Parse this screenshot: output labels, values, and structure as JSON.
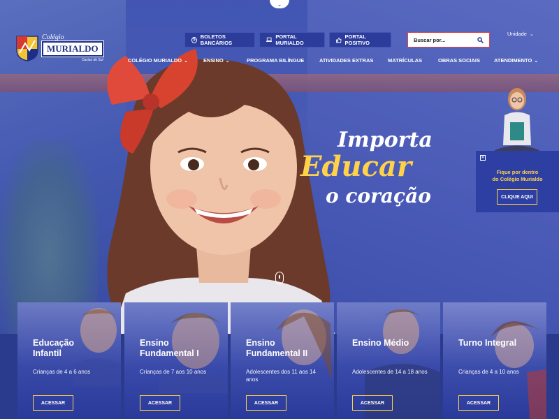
{
  "header": {
    "logo_small": "Colégio",
    "logo_big": "MURIALDO",
    "logo_sub": "Caxias do Sul",
    "buttons": [
      {
        "label": "BOLETOS BANCÁRIOS",
        "icon": "dollar-circle-icon"
      },
      {
        "label": "PORTAL MURIALDO",
        "icon": "laptop-icon"
      },
      {
        "label": "PORTAL POSITIVO",
        "icon": "thumbs-up-icon"
      }
    ],
    "search_placeholder": "Buscar por...",
    "unit_label": "Unidade"
  },
  "nav": [
    {
      "label": "COLÉGIO MURIALDO",
      "dropdown": true
    },
    {
      "label": "ENSINO",
      "dropdown": true
    },
    {
      "label": "PROGRAMA BILÍNGUE",
      "dropdown": false
    },
    {
      "label": "ATIVIDADES EXTRAS",
      "dropdown": false
    },
    {
      "label": "MATRÍCULAS",
      "dropdown": false
    },
    {
      "label": "OBRAS SOCIAIS",
      "dropdown": false
    },
    {
      "label": "ATENDIMENTO",
      "dropdown": true
    }
  ],
  "hero": {
    "line1": "Importa",
    "line2": "Educar",
    "line3": "o coração"
  },
  "side_card": {
    "text_line1": "Fique por dentro",
    "text_line2": "do Colégio Murialdo",
    "button": "CLIQUE AQUI"
  },
  "cards": [
    {
      "title_line1": "Educação",
      "title_line2": "Infantil",
      "desc": "Crianças de 4 a 6 anos",
      "button": "ACESSAR"
    },
    {
      "title_line1": "Ensino",
      "title_line2": "Fundamental I",
      "desc": "Crianças de 7 aos 10 anos",
      "button": "ACESSAR"
    },
    {
      "title_line1": "Ensino",
      "title_line2": "Fundamental II",
      "desc": "Adolescentes dos 11 aos 14 anos",
      "button": "ACESSAR"
    },
    {
      "title_line1": "Ensino Médio",
      "title_line2": "",
      "desc": "Adolescentes de 14 a 18 anos",
      "button": "ACESSAR"
    },
    {
      "title_line1": "Turno Integral",
      "title_line2": "",
      "desc": "Crianças de 4 a 10 anos",
      "button": "ACESSAR"
    }
  ],
  "colors": {
    "primary": "#2c3c9b",
    "accent_yellow": "#ffd24a",
    "bow_red": "#e04a3a"
  }
}
